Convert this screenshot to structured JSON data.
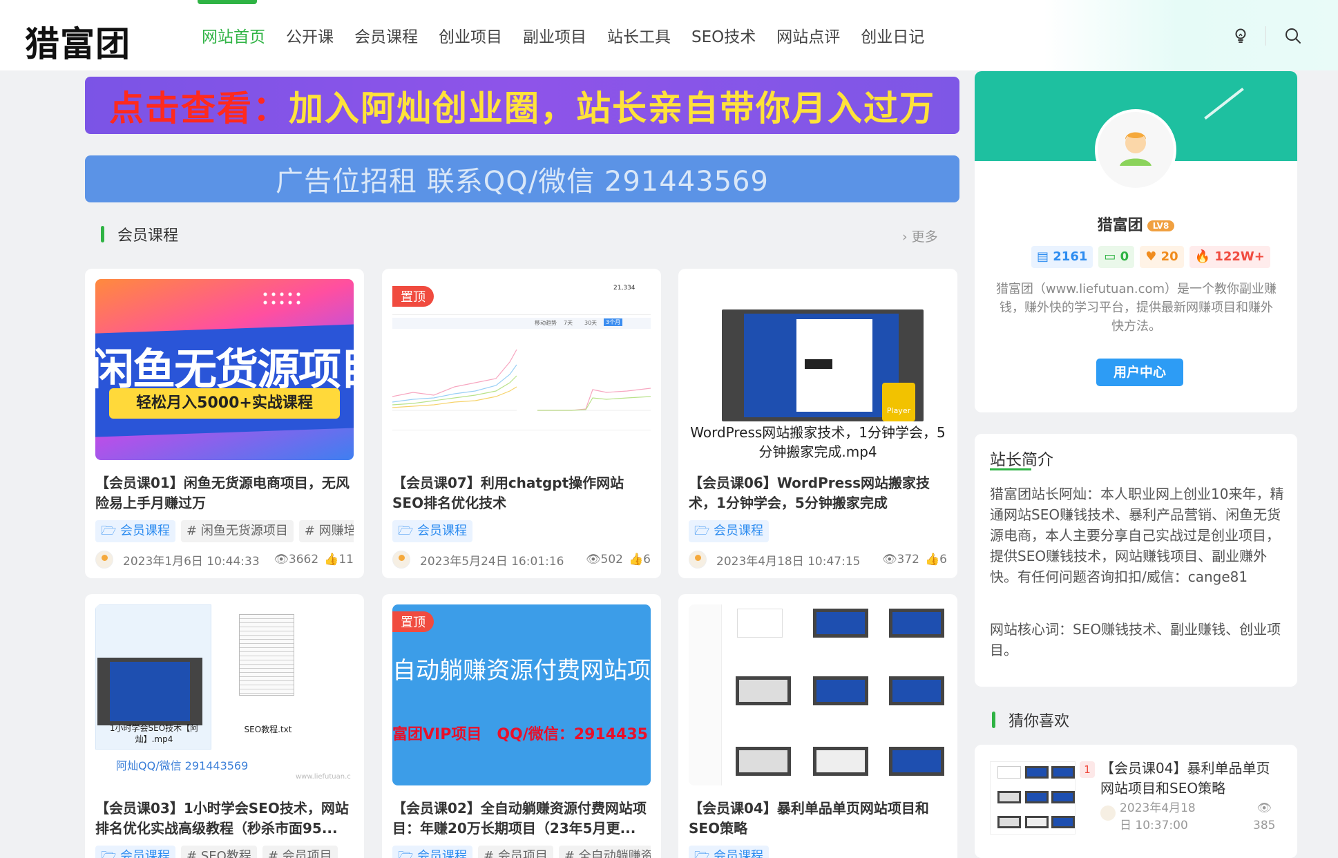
{
  "header": {
    "logo": "猎富团",
    "nav": [
      "网站首页",
      "公开课",
      "会员课程",
      "创业项目",
      "副业项目",
      "站长工具",
      "SEO技术",
      "网站点评",
      "创业日记"
    ],
    "active_index": 0
  },
  "banners": {
    "top_red": "点击查看：",
    "top_yellow": "加入阿灿创业圈，站长亲自带你月入过万",
    "ad": "广告位招租 联系QQ/微信 291443569"
  },
  "section": {
    "title": "会员课程",
    "more": "更多"
  },
  "cards": [
    {
      "title": "【会员课01】闲鱼无货源电商项目，无风险易上手月赚过万",
      "category": "会员课程",
      "tags": [
        "# 闲鱼无货源项目",
        "# 网赚培训"
      ],
      "date": "2023年1月6日 10:44:33",
      "views": "3662",
      "likes": "11",
      "pinned": false,
      "thumb_big": "闲鱼无货源项目",
      "thumb_sub": "轻松月入5000+实战课程"
    },
    {
      "title": "【会员课07】利用chatgpt操作网站SEO排名优化技术",
      "category": "会员课程",
      "tags": [],
      "date": "2023年5月24日 16:01:16",
      "views": "502",
      "likes": "6",
      "pinned": true,
      "thumb_top_num": "21,334",
      "thumb_tabs": [
        "移动趋势",
        "7天",
        "30天",
        "3个月"
      ]
    },
    {
      "title": "【会员课06】WordPress网站搬家技术，1分钟学会，5分钟搬家完成",
      "category": "会员课程",
      "tags": [],
      "date": "2023年4月18日 10:47:15",
      "views": "372",
      "likes": "6",
      "pinned": false,
      "thumb_caption": "WordPress网站搬家技术，1分钟学会，5分钟搬家完成.mp4",
      "thumb_player": "Player"
    },
    {
      "title": "【会员课03】1小时学会SEO技术，网站排名优化实战高级教程（秒杀市面95...",
      "category": "会员课程",
      "tags": [
        "# SEO教程",
        "# 会员项目"
      ],
      "pinned": false,
      "thumb_file1": "1小时学会SEO技术【阿灿】.mp4",
      "thumb_file2": "SEO教程.txt",
      "thumb_contact": "阿灿QQ/微信 291443569",
      "thumb_wm": "www.liefutuan.c"
    },
    {
      "title": "【会员课02】全自动躺赚资源付费网站项目：年赚20万长期项目（23年5月更...",
      "category": "会员课程",
      "tags": [
        "# 会员项目",
        "# 全自动躺赚资源"
      ],
      "pinned": true,
      "thumb_line1": "自动躺赚资源付费网站项",
      "thumb_line2": "富团VIP项目　QQ/微信：2914435"
    },
    {
      "title": "【会员课04】暴利单品单页网站项目和SEO策略",
      "category": "会员课程",
      "tags": [],
      "pinned": false
    }
  ],
  "pin_label": "置顶",
  "profile": {
    "name": "猎富团",
    "level": "LV8",
    "stats": {
      "posts": "2161",
      "comments": "0",
      "likes": "20",
      "views": "122W+"
    },
    "desc": "猎富团（www.liefutuan.com）是一个教你副业赚钱，赚外快的学习平台，提供最新网赚项目和赚外快方法。",
    "button": "用户中心"
  },
  "intro": {
    "title": "站长简介",
    "p1": "猎富团站长阿灿：本人职业网上创业10来年，精通网站SEO赚钱技术、暴利产品营销、闲鱼无货源电商，本人主要分享自己实战过是创业项目，提供SEO赚钱技术，网站赚钱项目、副业赚外快。有任何问题咨询扣扣/威信：cange81",
    "p2": "网站核心词：SEO赚钱技术、副业赚钱、创业项目。"
  },
  "guess": {
    "title": "猜你喜欢",
    "item": {
      "rank": "1",
      "title": "【会员课04】暴利单品单页网站项目和SEO策略",
      "date": "2023年4月18日 10:37:00",
      "views": "385"
    }
  },
  "colors": {
    "green": "#2fb344",
    "blue": "#2d8cf0",
    "red": "#f04b3f",
    "teal": "#1ec0a0"
  }
}
